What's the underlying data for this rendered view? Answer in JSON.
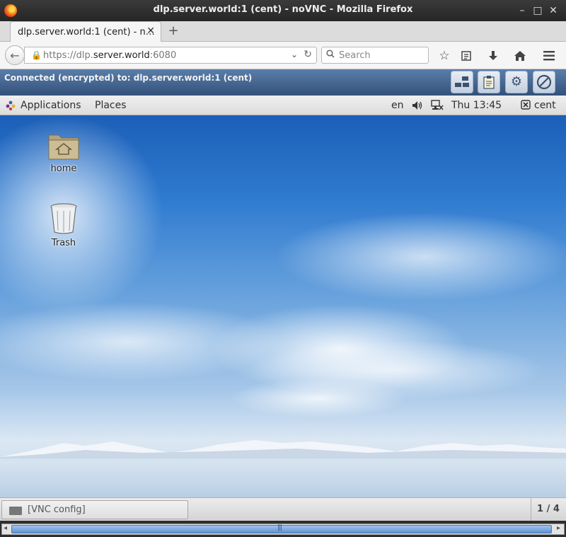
{
  "window": {
    "title": "dlp.server.world:1 (cent) - noVNC - Mozilla Firefox",
    "minimize": "–",
    "maximize": "□",
    "close": "✕"
  },
  "tab": {
    "label": "dlp.server.world:1 (cent) - n…",
    "close": "✕",
    "new_tab": "+"
  },
  "navbar": {
    "back": "←",
    "url_scheme": "https://dlp.",
    "url_host": "server.world",
    "url_port": ":6080",
    "dropdown": "⌄",
    "reload": "↻",
    "search_placeholder": "Search"
  },
  "vnc": {
    "status": "Connected (encrypted) to: dlp.server.world:1 (cent)"
  },
  "gnome_panel": {
    "applications": "Applications",
    "places": "Places",
    "keyboard_layout": "en",
    "clock": "Thu 13:45",
    "user": "cent"
  },
  "desktop": {
    "icons": [
      {
        "label": "home"
      },
      {
        "label": "Trash"
      }
    ]
  },
  "bottom_panel": {
    "task_label": "[VNC config]",
    "workspace": "1 / 4"
  },
  "scrollbar": {
    "left_arrow": "◂",
    "right_arrow": "▸",
    "grip": "|||"
  }
}
